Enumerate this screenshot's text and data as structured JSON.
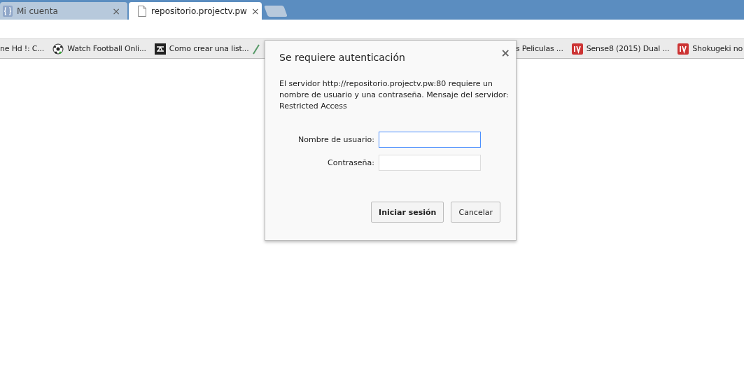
{
  "tabs": [
    {
      "label": "Mi cuenta",
      "close": "×",
      "selected": false,
      "kind": "app"
    },
    {
      "label": "repositorio.projectv.pw",
      "close": "×",
      "selected": true,
      "kind": "page"
    }
  ],
  "bookmarks": [
    {
      "label": "ne Hd !: C...",
      "kind": "text"
    },
    {
      "label": "Watch Football Onli...",
      "kind": "ball"
    },
    {
      "label": "Como crear una list...",
      "kind": "dark"
    },
    {
      "kind": "pencil"
    },
    {
      "label": "s Peliculas ...",
      "kind": "text"
    },
    {
      "label": "Sense8 (2015) Dual ...",
      "kind": "tv"
    },
    {
      "label": "Shokugeki no",
      "kind": "tv"
    }
  ],
  "dialog": {
    "title": "Se requiere autenticación",
    "close": "×",
    "message": "El servidor http://repositorio.projectv.pw:80 requiere un nombre de usuario y una contraseña. Mensaje del servidor: Restricted Access",
    "fields": [
      {
        "label": "Nombre de usuario:",
        "focused": true
      },
      {
        "label": "Contraseña:",
        "focused": false
      }
    ],
    "buttons": [
      {
        "label": "Iniciar sesión",
        "primary": true
      },
      {
        "label": "Cancelar",
        "primary": false
      }
    ]
  }
}
